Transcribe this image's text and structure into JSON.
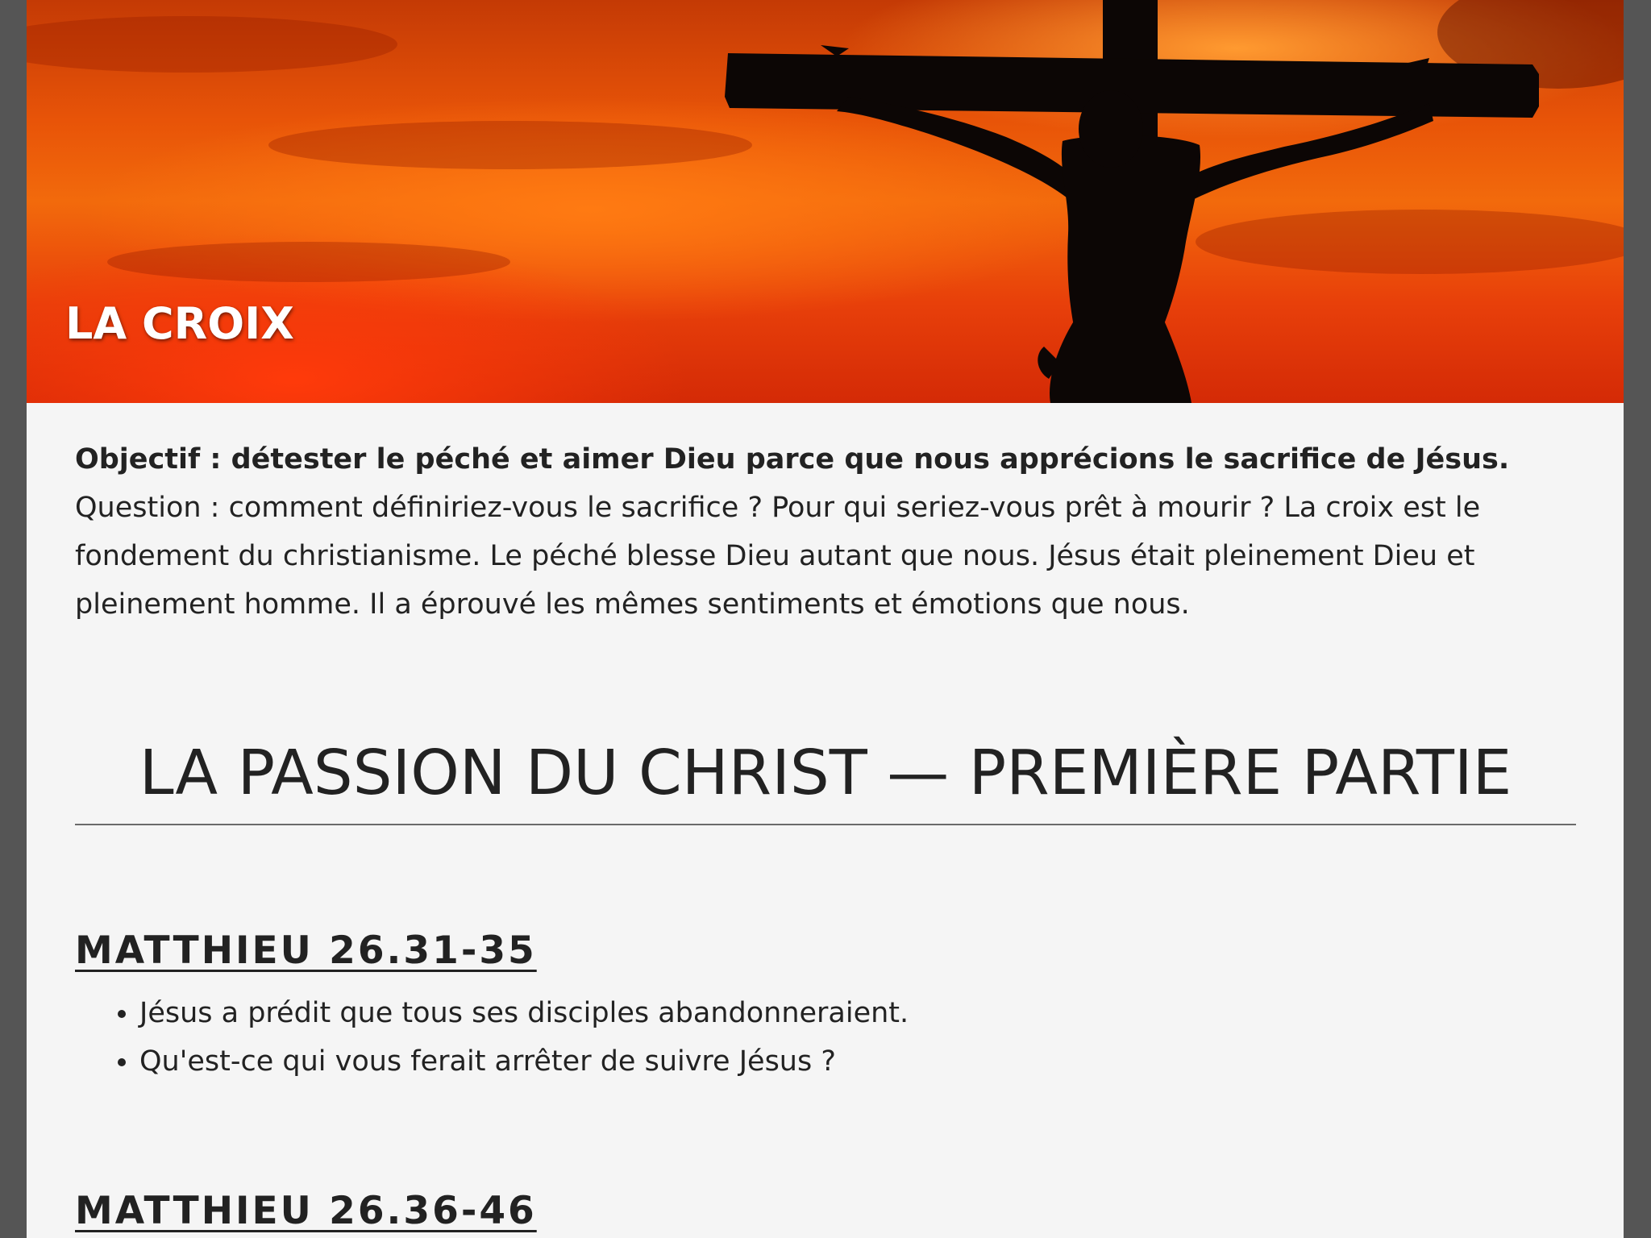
{
  "hero": {
    "title": "LA CROIX"
  },
  "intro": {
    "objective_bold": "Objectif : détester le péché et aimer Dieu parce que nous apprécions le sacrifice de Jésus.",
    "text": " Question : comment définiriez-vous le sacrifice ? Pour qui seriez-vous prêt à mourir ? La croix est le fondement du christianisme. Le péché blesse Dieu autant que nous. Jésus était pleinement Dieu et pleinement homme. Il a éprouvé les mêmes sentiments et émotions que nous."
  },
  "section": {
    "title": "LA PASSION DU CHRIST — PREMIÈRE PARTIE"
  },
  "passages": [
    {
      "title": "MATTHIEU 26.31-35",
      "bullets": [
        "Jésus a prédit que tous ses disciples abandonneraient.",
        "Qu'est-ce qui vous ferait arrêter de suivre Jésus ?"
      ]
    },
    {
      "title": "MATTHIEU 26.36-46"
    }
  ],
  "colors": {
    "sky_orange": "#f26a0c",
    "sky_red": "#d42a06",
    "page_background": "#f5f5f5",
    "text": "#222222",
    "outer_background": "#555555"
  }
}
